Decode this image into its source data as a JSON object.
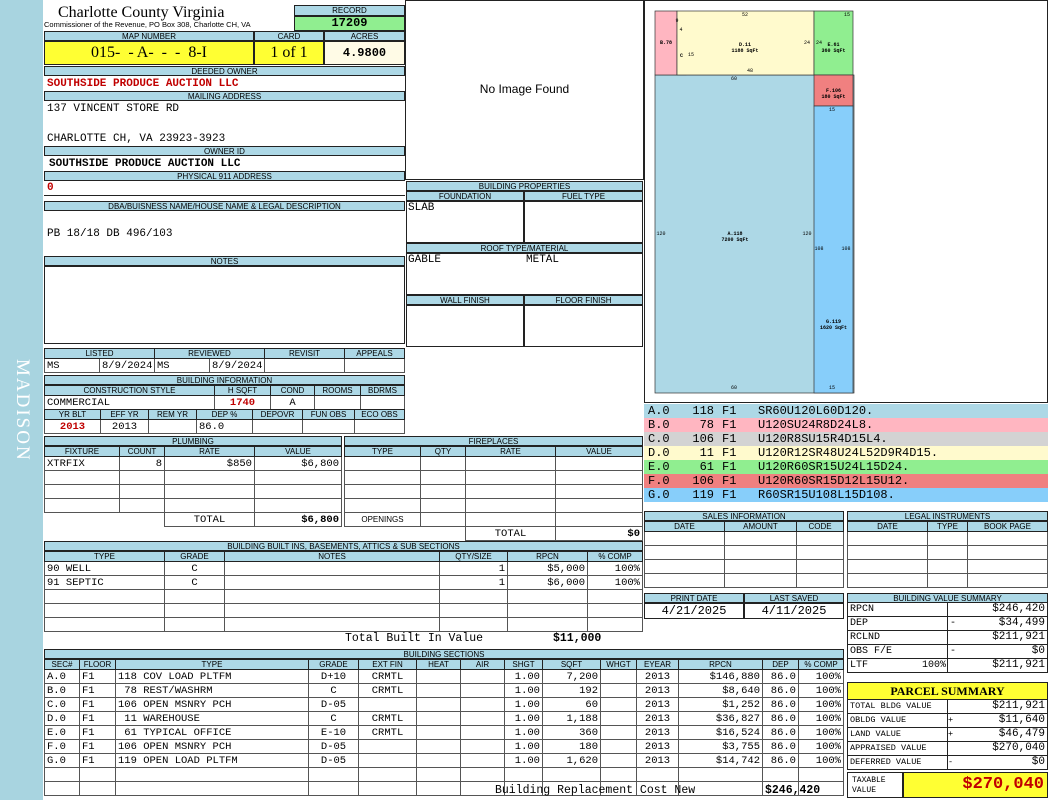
{
  "sidebar": {
    "label": "MADISON"
  },
  "header": {
    "county": "Charlotte County Virginia",
    "commissioner": "Commissioner of the Revenue, PO Box 308, Charlotte CH, VA",
    "record_label": "RECORD",
    "record": "17209",
    "map_label": "MAP NUMBER",
    "map": "015-  - A-  -  -  8-I",
    "card_label": "CARD",
    "card": "1 of 1",
    "acres_label": "ACRES",
    "acres": "4.9800"
  },
  "owner": {
    "deeded_label": "DEEDED OWNER",
    "deeded": "SOUTHSIDE PRODUCE AUCTION LLC",
    "mailing_label": "MAILING ADDRESS",
    "addr1": "137 VINCENT STORE RD",
    "addr2": "CHARLOTTE CH, VA 23923-3923",
    "ownerid_label": "OWNER ID",
    "ownerid": "SOUTHSIDE PRODUCE AUCTION LLC",
    "phys_label": "PHYSICAL 911 ADDRESS",
    "phys": "0"
  },
  "legal": {
    "label": "DBA/BUISNESS NAME/HOUSE NAME & LEGAL DESCRIPTION",
    "text": "PB 18/18 DB 496/103"
  },
  "notes": {
    "label": "NOTES"
  },
  "photo": {
    "text": "No Image Found"
  },
  "listing": {
    "listed_label": "LISTED",
    "reviewed_label": "REVIEWED",
    "revisit_label": "REVISIT",
    "appeals_label": "APPEALS",
    "listed_by": "MS",
    "listed_date": "8/9/2024",
    "reviewed_by": "MS",
    "reviewed_date": "8/9/2024"
  },
  "bldg_info": {
    "label": "BUILDING INFORMATION",
    "style_label": "CONSTRUCTION STYLE",
    "hsqft_label": "H SQFT",
    "cond_label": "COND",
    "rooms_label": "ROOMS",
    "bdrms_label": "BDRMS",
    "style": "COMMERCIAL",
    "hsqft": "1740",
    "cond": "A",
    "yrblt_label": "YR BLT",
    "effyr_label": "EFF YR",
    "remyr_label": "REM YR",
    "dep_label": "DEP %",
    "depovr_label": "DEPOVR",
    "funobs_label": "FUN OBS",
    "ecoobs_label": "ECO OBS",
    "yrblt": "2013",
    "effyr": "2013",
    "dep": "86.0"
  },
  "props": {
    "label": "BUILDING PROPERTIES",
    "foundation_label": "FOUNDATION",
    "fuel_label": "FUEL TYPE",
    "foundation": "SLAB",
    "roof_label": "ROOF TYPE/MATERIAL",
    "roof_type": "GABLE",
    "roof_mat": "METAL",
    "wall_label": "WALL FINISH",
    "floor_label": "FLOOR FINISH"
  },
  "plumbing": {
    "label": "PLUMBING",
    "cols": [
      "FIXTURE",
      "COUNT",
      "RATE",
      "VALUE"
    ],
    "rows": [
      [
        "XTRFIX",
        "8",
        "$850",
        "$6,800"
      ],
      [
        "",
        "",
        "",
        ""
      ],
      [
        "",
        "",
        "",
        ""
      ],
      [
        "",
        "",
        "",
        ""
      ]
    ],
    "total_label": "TOTAL",
    "total": "$6,800"
  },
  "fireplaces": {
    "label": "FIREPLACES",
    "cols": [
      "TYPE",
      "QTY",
      "RATE",
      "VALUE"
    ],
    "openings_label": "OPENINGS",
    "total_label": "TOTAL",
    "total": "$0"
  },
  "builtins": {
    "label": "BUILDING BUILT INS, BASEMENTS, ATTICS & SUB SECTIONS",
    "cols": [
      "TYPE",
      "GRADE",
      "NOTES",
      "QTY/SIZE",
      "RPCN",
      "% COMP"
    ],
    "rows": [
      [
        "90 WELL",
        "C",
        "",
        "1",
        "$5,000",
        "100%"
      ],
      [
        "91 SEPTIC",
        "C",
        "",
        "1",
        "$6,000",
        "100%"
      ]
    ],
    "total_label": "Total Built In Value",
    "total": "$11,000"
  },
  "sections": {
    "label": "BUILDING SECTIONS",
    "cols": [
      "SEC#",
      "FLOOR",
      "TYPE",
      "GRADE",
      "EXT FIN",
      "HEAT",
      "AIR",
      "SHGT",
      "SQFT",
      "WHGT",
      "EYEAR",
      "RPCN",
      "DEP",
      "% COMP"
    ],
    "rows": [
      [
        "A.0",
        "F1",
        "118 COV LOAD PLTFM",
        "D+10",
        "CRMTL",
        "",
        "",
        "1.00",
        "7,200",
        "",
        "2013",
        "$146,880",
        "86.0",
        "100%"
      ],
      [
        "B.0",
        "F1",
        " 78 REST/WASHRM",
        "C",
        "CRMTL",
        "",
        "",
        "1.00",
        "192",
        "",
        "2013",
        "$8,640",
        "86.0",
        "100%"
      ],
      [
        "C.0",
        "F1",
        "106 OPEN MSNRY PCH",
        "D-05",
        "",
        "",
        "",
        "1.00",
        "60",
        "",
        "2013",
        "$1,252",
        "86.0",
        "100%"
      ],
      [
        "D.0",
        "F1",
        " 11 WAREHOUSE",
        "C",
        "CRMTL",
        "",
        "",
        "1.00",
        "1,188",
        "",
        "2013",
        "$36,827",
        "86.0",
        "100%"
      ],
      [
        "E.0",
        "F1",
        " 61 TYPICAL OFFICE",
        "E-10",
        "CRMTL",
        "",
        "",
        "1.00",
        "360",
        "",
        "2013",
        "$16,524",
        "86.0",
        "100%"
      ],
      [
        "F.0",
        "F1",
        "106 OPEN MSNRY PCH",
        "D-05",
        "",
        "",
        "",
        "1.00",
        "180",
        "",
        "2013",
        "$3,755",
        "86.0",
        "100%"
      ],
      [
        "G.0",
        "F1",
        "119 OPEN LOAD PLTFM",
        "D-05",
        "",
        "",
        "",
        "1.00",
        "1,620",
        "",
        "2013",
        "$14,742",
        "86.0",
        "100%"
      ]
    ],
    "total_label": "Building Replacement Cost New",
    "total": "$246,420"
  },
  "sketch": {
    "labels": {
      "A": "A.118\n7200 SqFt",
      "B": "B.78",
      "C": "C",
      "D": "D.11\n1188 SqFt",
      "E": "E.61\n360 SqFt",
      "F": "F.106\n180 SqFt",
      "G": "G.119\n1620 SqFt"
    },
    "dims": [
      "52",
      "15",
      "9",
      "4",
      "15",
      "24",
      "24",
      "48",
      "60",
      "15",
      "120",
      "120",
      "108",
      "108",
      "15",
      "60"
    ],
    "areas": [
      {
        "code": "A.0",
        "n": "118",
        "f": "F1",
        "path": "SR60U120L60D120.",
        "color": "#add8e6"
      },
      {
        "code": "B.0",
        "n": "78",
        "f": "F1",
        "path": "U120SU24R8D24L8.",
        "color": "#ffb6c1"
      },
      {
        "code": "C.0",
        "n": "106",
        "f": "F1",
        "path": "U120R8SU15R4D15L4.",
        "color": "#d3d3d3"
      },
      {
        "code": "D.0",
        "n": "11",
        "f": "F1",
        "path": "U120R12SR48U24L52D9R4D15.",
        "color": "#fffacd"
      },
      {
        "code": "E.0",
        "n": "61",
        "f": "F1",
        "path": "U120R60SR15U24L15D24.",
        "color": "#90ee90"
      },
      {
        "code": "F.0",
        "n": "106",
        "f": "F1",
        "path": "U120R60SR15D12L15U12.",
        "color": "#f08080"
      },
      {
        "code": "G.0",
        "n": "119",
        "f": "F1",
        "path": "R60SR15U108L15D108.",
        "color": "#87cefa"
      }
    ]
  },
  "sales": {
    "label": "SALES INFORMATION",
    "cols": [
      "DATE",
      "AMOUNT",
      "CODE"
    ]
  },
  "legal_inst": {
    "label": "LEGAL INSTRUMENTS",
    "cols": [
      "DATE",
      "TYPE",
      "BOOK PAGE"
    ]
  },
  "print": {
    "print_label": "PRINT DATE",
    "saved_label": "LAST SAVED",
    "print_date": "4/21/2025",
    "saved_date": "4/11/2025"
  },
  "bvs": {
    "label": "BUILDING VALUE SUMMARY",
    "rows": [
      {
        "k": "RPCN",
        "s": "",
        "v": "$246,420"
      },
      {
        "k": "DEP",
        "s": "-",
        "v": "$34,499"
      },
      {
        "k": "RCLND",
        "s": "",
        "v": "$211,921"
      },
      {
        "k": "OBS F/E",
        "s": "-",
        "v": "$0"
      },
      {
        "k": "LTF",
        "s": "100%",
        "v": "$211,921"
      }
    ]
  },
  "parcel": {
    "label": "PARCEL SUMMARY",
    "rows": [
      {
        "k": "TOTAL BLDG VALUE",
        "s": "",
        "v": "$211,921"
      },
      {
        "k": "OBLDG VALUE",
        "s": "+",
        "v": "$11,640"
      },
      {
        "k": "LAND VALUE",
        "s": "+",
        "v": "$46,479"
      },
      {
        "k": "APPRAISED VALUE",
        "s": "",
        "v": "$270,040"
      },
      {
        "k": "DEFERRED VALUE",
        "s": "-",
        "v": "$0"
      }
    ],
    "taxable_label": "TAXABLE VALUE",
    "taxable": "$270,040"
  }
}
